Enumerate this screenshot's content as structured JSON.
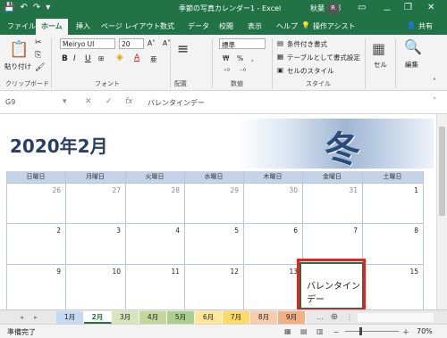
{
  "window": {
    "title": "季節の写真カレンダー1 - Excel",
    "user": "秋葉 一郎",
    "avatar": "R",
    "minimize": "－",
    "restore": "❐",
    "close": "✕"
  },
  "qat": {
    "save": "💾",
    "undo": "↶",
    "redo": "↷",
    "dropdown": "▾"
  },
  "tabs": [
    "ファイル",
    "ホーム",
    "挿入",
    "ページ レイアウト",
    "数式",
    "データ",
    "校閲",
    "表示",
    "ヘルプ",
    "操作アシスト"
  ],
  "share": "共有",
  "ribbon": {
    "clipboard": {
      "paste": "貼り付け",
      "label": "クリップボード"
    },
    "font": {
      "name": "Meiryo UI",
      "size": "20",
      "label": "フォント",
      "bold": "B",
      "italic": "I",
      "underline": "U"
    },
    "align": {
      "label": "配置"
    },
    "number": {
      "format": "標準",
      "label": "数値",
      "percent": "%"
    },
    "styles": {
      "cond": "条件付き書式",
      "table": "テーブルとして書式設定",
      "cell": "セルのスタイル",
      "label": "スタイル"
    },
    "cells": {
      "label": "セル"
    },
    "edit": {
      "label": "編集"
    }
  },
  "formula": {
    "namebox": "G9",
    "cancel": "✕",
    "confirm": "✓",
    "fx": "fx",
    "value": "バレンタインデー"
  },
  "calendar": {
    "title": "2020年2月",
    "image_kanji": "冬",
    "days": [
      "日曜日",
      "月曜日",
      "火曜日",
      "水曜日",
      "木曜日",
      "金曜日",
      "土曜日"
    ],
    "weeks": [
      [
        "26",
        "27",
        "28",
        "29",
        "30",
        "31",
        "1"
      ],
      [
        "2",
        "3",
        "4",
        "5",
        "6",
        "7",
        "8"
      ],
      [
        "9",
        "10",
        "11",
        "12",
        "13",
        "14",
        "15"
      ]
    ],
    "event": "バレンタインデー"
  },
  "sheets": [
    "1月",
    "2月",
    "3月",
    "4月",
    "5月",
    "6月",
    "7月",
    "8月",
    "9月"
  ],
  "sheet_colors": [
    "#c5d9f1",
    "#ffffff",
    "#d8e4bc",
    "#c4d79b",
    "#a9d08e",
    "#ffe699",
    "#ffd966",
    "#f8cbad",
    "#f4b084"
  ],
  "active_sheet": "2月",
  "status": {
    "text": "準備完了",
    "zoom": "70%",
    "minus": "－",
    "plus": "＋"
  },
  "ellipsis": "..."
}
